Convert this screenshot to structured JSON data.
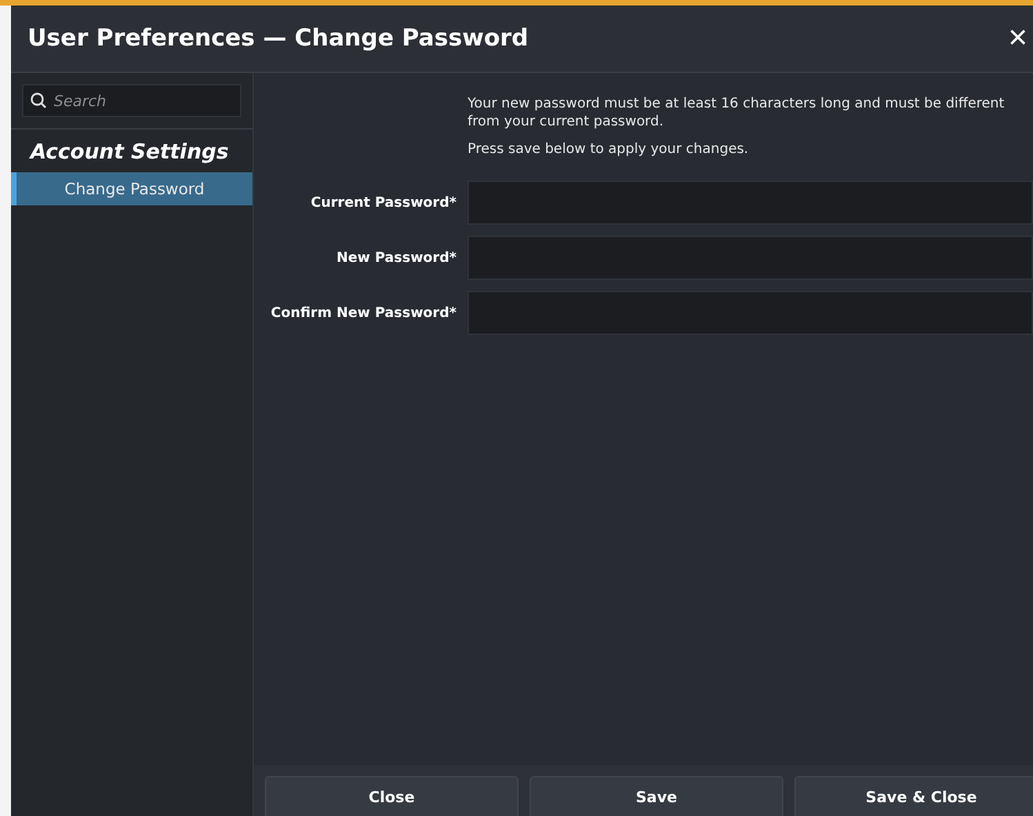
{
  "window": {
    "title": "User Preferences — Change Password",
    "close": "×"
  },
  "sidebar": {
    "search": {
      "placeholder": "Search"
    },
    "section": "Account Settings",
    "items": [
      {
        "label": "Change Password",
        "selected": true
      }
    ]
  },
  "info": [
    "Your new password must be at least 16 characters long and must be different from your current password.",
    "Press save below to apply your changes."
  ],
  "fields": [
    {
      "label": "Current Password*"
    },
    {
      "label": "New Password*"
    },
    {
      "label": "Confirm New Password*"
    }
  ],
  "buttons": [
    "Close",
    "Save",
    "Save & Close"
  ]
}
